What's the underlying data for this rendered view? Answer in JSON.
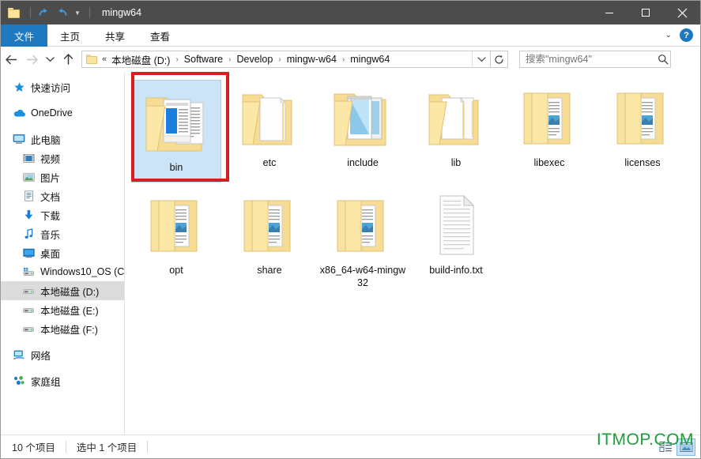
{
  "window": {
    "title": "mingw64",
    "quick_access": {
      "folder_icon": "folder-icon",
      "undo_icon": "undo-arrow-icon",
      "redo_icon": "redo-arrow-icon",
      "customize_icon": "chevron-down-icon"
    },
    "controls": {
      "minimize": "minimize-icon",
      "maximize": "maximize-icon",
      "close": "close-icon"
    }
  },
  "ribbon": {
    "tabs": [
      {
        "label": "文件",
        "active": true
      },
      {
        "label": "主页",
        "active": false
      },
      {
        "label": "共享",
        "active": false
      },
      {
        "label": "查看",
        "active": false
      }
    ],
    "expand_icon": "chevron-down-icon",
    "help_label": "?"
  },
  "address": {
    "back_icon": "arrow-left-icon",
    "forward_icon": "arrow-right-icon",
    "recent_icon": "chevron-down-icon",
    "up_icon": "arrow-up-icon",
    "overflow": "«",
    "crumbs": [
      "本地磁盘 (D:)",
      "Software",
      "Develop",
      "mingw-w64",
      "mingw64"
    ],
    "separator": "›",
    "dropdown_icon": "chevron-down-icon",
    "refresh_icon": "refresh-icon"
  },
  "search": {
    "placeholder": "搜索\"mingw64\"",
    "value": "",
    "icon": "search-icon"
  },
  "sidebar": {
    "items": [
      {
        "label": "快速访问",
        "icon": "star-icon",
        "indent": false,
        "selected": false,
        "gap": false
      },
      {
        "label": "OneDrive",
        "icon": "cloud-icon",
        "indent": false,
        "selected": false,
        "gap": true
      },
      {
        "label": "此电脑",
        "icon": "monitor-icon",
        "indent": false,
        "selected": false,
        "gap": true
      },
      {
        "label": "视频",
        "icon": "video-icon",
        "indent": true,
        "selected": false,
        "gap": false
      },
      {
        "label": "图片",
        "icon": "picture-icon",
        "indent": true,
        "selected": false,
        "gap": false
      },
      {
        "label": "文档",
        "icon": "document-icon",
        "indent": true,
        "selected": false,
        "gap": false
      },
      {
        "label": "下载",
        "icon": "download-icon",
        "indent": true,
        "selected": false,
        "gap": false
      },
      {
        "label": "音乐",
        "icon": "music-icon",
        "indent": true,
        "selected": false,
        "gap": false
      },
      {
        "label": "桌面",
        "icon": "desktop-icon",
        "indent": true,
        "selected": false,
        "gap": false
      },
      {
        "label": "Windows10_OS (C",
        "icon": "system-drive-icon",
        "indent": true,
        "selected": false,
        "gap": false
      },
      {
        "label": "本地磁盘 (D:)",
        "icon": "drive-icon",
        "indent": true,
        "selected": true,
        "gap": false
      },
      {
        "label": "本地磁盘 (E:)",
        "icon": "drive-icon",
        "indent": true,
        "selected": false,
        "gap": false
      },
      {
        "label": "本地磁盘 (F:)",
        "icon": "drive-icon",
        "indent": true,
        "selected": false,
        "gap": false
      },
      {
        "label": "网络",
        "icon": "network-icon",
        "indent": false,
        "selected": false,
        "gap": true
      },
      {
        "label": "家庭组",
        "icon": "homegroup-icon",
        "indent": false,
        "selected": false,
        "gap": true
      }
    ]
  },
  "files": {
    "items": [
      {
        "name": "bin",
        "type": "folder",
        "variant": "blue-doc",
        "selected": true,
        "annotated": true
      },
      {
        "name": "etc",
        "type": "folder",
        "variant": "white-doc",
        "selected": false,
        "annotated": false
      },
      {
        "name": "include",
        "type": "folder",
        "variant": "photo",
        "selected": false,
        "annotated": false
      },
      {
        "name": "lib",
        "type": "folder",
        "variant": "white-doc",
        "selected": false,
        "annotated": false
      },
      {
        "name": "libexec",
        "type": "folder",
        "variant": "lines-doc",
        "selected": false,
        "annotated": false
      },
      {
        "name": "licenses",
        "type": "folder",
        "variant": "lines-doc",
        "selected": false,
        "annotated": false
      },
      {
        "name": "opt",
        "type": "folder",
        "variant": "lines-doc",
        "selected": false,
        "annotated": false
      },
      {
        "name": "share",
        "type": "folder",
        "variant": "lines-doc",
        "selected": false,
        "annotated": false
      },
      {
        "name": "x86_64-w64-mingw32",
        "type": "folder",
        "variant": "lines-doc",
        "selected": false,
        "annotated": false
      },
      {
        "name": "build-info.txt",
        "type": "textfile",
        "variant": "text",
        "selected": false,
        "annotated": false
      }
    ]
  },
  "status": {
    "item_count": "10 个项目",
    "selection": "选中 1 个项目",
    "view_list_icon": "list-view-icon",
    "view_large_icon": "large-icons-view-icon"
  },
  "watermark": {
    "text": "ITMOP.COM",
    "color": "#1f9e3d"
  },
  "annotation": {
    "color": "#d42020",
    "target": "bin"
  }
}
